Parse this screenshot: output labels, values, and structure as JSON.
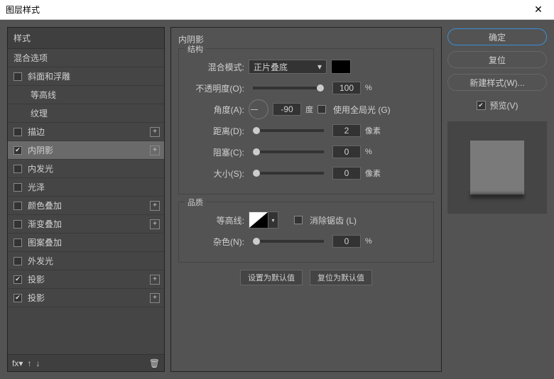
{
  "title": "图层样式",
  "sidebar": {
    "header": "样式",
    "blend": "混合选项",
    "items": [
      {
        "label": "斜面和浮雕",
        "checked": false,
        "plus": false
      },
      {
        "label": "等高线",
        "checked": false,
        "indent": true
      },
      {
        "label": "纹理",
        "checked": false,
        "indent": true
      },
      {
        "label": "描边",
        "checked": false,
        "plus": true
      },
      {
        "label": "内阴影",
        "checked": true,
        "plus": true,
        "selected": true
      },
      {
        "label": "内发光",
        "checked": false
      },
      {
        "label": "光泽",
        "checked": false
      },
      {
        "label": "颜色叠加",
        "checked": false,
        "plus": true
      },
      {
        "label": "渐变叠加",
        "checked": false,
        "plus": true
      },
      {
        "label": "图案叠加",
        "checked": false
      },
      {
        "label": "外发光",
        "checked": false
      },
      {
        "label": "投影",
        "checked": true,
        "plus": true
      },
      {
        "label": "投影",
        "checked": true,
        "plus": true
      }
    ],
    "fx": "fx"
  },
  "panel": {
    "title": "内阴影",
    "structure": "结构",
    "quality": "品质",
    "blend_mode_label": "混合模式:",
    "blend_mode_value": "正片叠底",
    "opacity_label": "不透明度(O):",
    "opacity_value": "100",
    "pct": "%",
    "angle_label": "角度(A):",
    "angle_value": "-90",
    "degree": "度",
    "global_light": "使用全局光 (G)",
    "distance_label": "距离(D):",
    "distance_value": "2",
    "px": "像素",
    "choke_label": "阻塞(C):",
    "choke_value": "0",
    "size_label": "大小(S):",
    "size_value": "0",
    "contour_label": "等高线:",
    "antialias": "消除锯齿 (L)",
    "noise_label": "杂色(N):",
    "noise_value": "0",
    "set_default": "设置为默认值",
    "reset_default": "复位为默认值"
  },
  "right": {
    "ok": "确定",
    "cancel": "复位",
    "new_style": "新建样式(W)...",
    "preview": "预览(V)"
  }
}
